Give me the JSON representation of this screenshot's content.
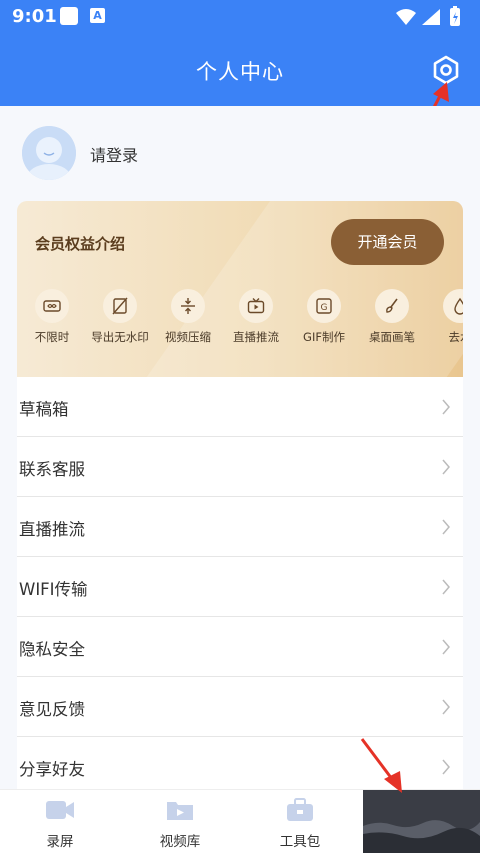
{
  "status_bar": {
    "time": "9:01",
    "notif_letter": "A"
  },
  "header": {
    "title": "个人中心"
  },
  "profile": {
    "login_text": "请登录"
  },
  "vip": {
    "title": "会员权益介绍",
    "open_button": "开通会员",
    "features": [
      {
        "label": "不限时",
        "icon": "infinity-icon"
      },
      {
        "label": "导出无水印",
        "icon": "no-watermark-icon"
      },
      {
        "label": "视频压缩",
        "icon": "compress-icon"
      },
      {
        "label": "直播推流",
        "icon": "live-tv-icon"
      },
      {
        "label": "GIF制作",
        "icon": "gif-icon"
      },
      {
        "label": "桌面画笔",
        "icon": "brush-icon"
      },
      {
        "label": "去水",
        "icon": "drop-icon"
      }
    ]
  },
  "menu": [
    {
      "label": "草稿箱"
    },
    {
      "label": "联系客服"
    },
    {
      "label": "直播推流"
    },
    {
      "label": "WIFI传输"
    },
    {
      "label": "隐私安全"
    },
    {
      "label": "意见反馈"
    },
    {
      "label": "分享好友"
    }
  ],
  "tabbar": [
    {
      "label": "录屏",
      "icon": "video-camera-icon"
    },
    {
      "label": "视频库",
      "icon": "video-folder-icon"
    },
    {
      "label": "工具包",
      "icon": "toolbox-icon"
    },
    {
      "label": "",
      "icon": "",
      "active": true
    }
  ],
  "colors": {
    "primary": "#3b82f6",
    "vip_button": "#8a5f35",
    "annotation": "#e53227"
  }
}
